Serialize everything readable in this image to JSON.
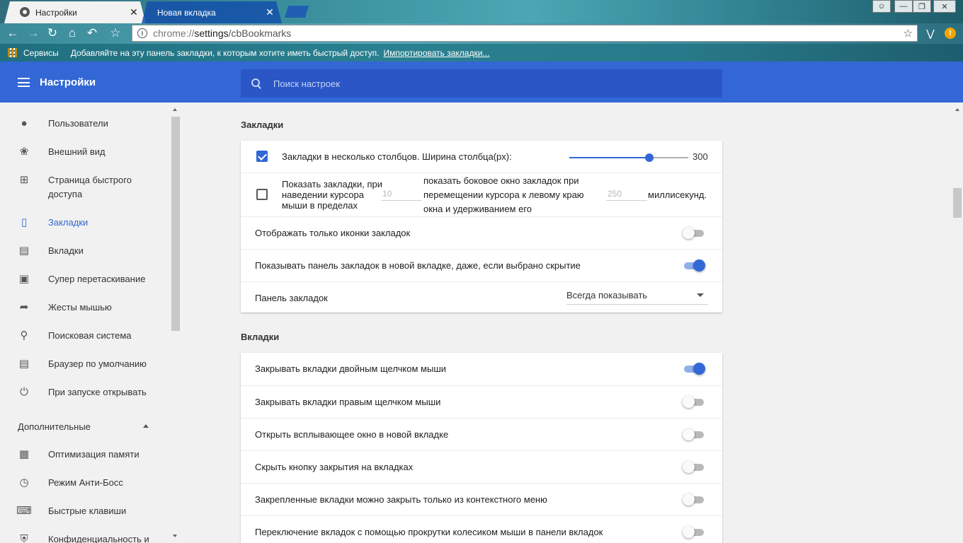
{
  "browser": {
    "tabs": [
      {
        "title": "Настройки",
        "close": "✕"
      },
      {
        "title": "Новая вкладка",
        "close": "✕"
      }
    ],
    "address": {
      "scheme": "chrome://",
      "host": "settings",
      "path": "/cbBookmarks"
    },
    "bookmarks_bar": {
      "apps": "Сервисы",
      "hint": "Добавляйте на эту панель закладки, к которым хотите иметь быстрый доступ.",
      "import": "Импортировать закладки..."
    }
  },
  "header": {
    "title": "Настройки",
    "search_placeholder": "Поиск настроек"
  },
  "sidebar": {
    "items": [
      {
        "label": "Пользователи",
        "icon": "person-icon"
      },
      {
        "label": "Внешний вид",
        "icon": "palette-icon"
      },
      {
        "label": "Страница быстрого доступа",
        "icon": "add-box-icon"
      },
      {
        "label": "Закладки",
        "icon": "bookmark-icon",
        "active": true
      },
      {
        "label": "Вкладки",
        "icon": "tab-icon"
      },
      {
        "label": "Супер перетаскивание",
        "icon": "drag-select-icon"
      },
      {
        "label": "Жесты мышью",
        "icon": "cursor-icon"
      },
      {
        "label": "Поисковая система",
        "icon": "search-icon"
      },
      {
        "label": "Браузер по умолчанию",
        "icon": "browser-icon"
      },
      {
        "label": "При запуске открывать",
        "icon": "power-icon"
      }
    ],
    "advanced_label": "Дополнительные",
    "advanced_items": [
      {
        "label": "Оптимизация памяти",
        "icon": "chip-icon"
      },
      {
        "label": "Режим Анти-Босс",
        "icon": "alarm-add-icon"
      },
      {
        "label": "Быстрые клавиши",
        "icon": "keyboard-icon"
      },
      {
        "label": "Конфиденциальность и",
        "icon": "shield-icon"
      }
    ]
  },
  "bookmarks_section": {
    "title": "Закладки",
    "multi_column": {
      "label": "Закладки в несколько столбцов. Ширина столбца(px):",
      "checked": true,
      "value": "300",
      "slider_fraction": 0.67
    },
    "hover": {
      "label_part1": "Показать закладки, при наведении курсора мыши в пределах",
      "value1": "10",
      "label_part2": "показать боковое окно закладок при перемещении курсора к левому краю окна и удерживанием его",
      "value2": "250",
      "label_part3": "миллисекунд.",
      "checked": false
    },
    "icons_only": {
      "label": "Отображать только иконки закладок",
      "on": false
    },
    "show_in_new_tab": {
      "label": "Показывать панель закладок в новой вкладке, даже, если выбрано скрытие",
      "on": true
    },
    "bar": {
      "label": "Панель закладок",
      "value": "Всегда показывать"
    }
  },
  "tabs_section": {
    "title": "Вкладки",
    "rows": [
      {
        "label": "Закрывать вкладки двойным щелчком мыши",
        "on": true
      },
      {
        "label": "Закрывать вкладки правым щелчком мыши",
        "on": false
      },
      {
        "label": "Открыть всплывающее окно в новой вкладке",
        "on": false
      },
      {
        "label": "Скрыть кнопку закрытия на вкладках",
        "on": false
      },
      {
        "label": "Закрепленные вкладки можно закрыть только из контекстного меню",
        "on": false
      },
      {
        "label": "Переключение вкладок с помощью прокрутки колесиком мыши в панели вкладок",
        "on": false
      }
    ]
  },
  "colors": {
    "accent": "#3367d6",
    "header": "#3367d6",
    "search": "#2a56c6"
  }
}
